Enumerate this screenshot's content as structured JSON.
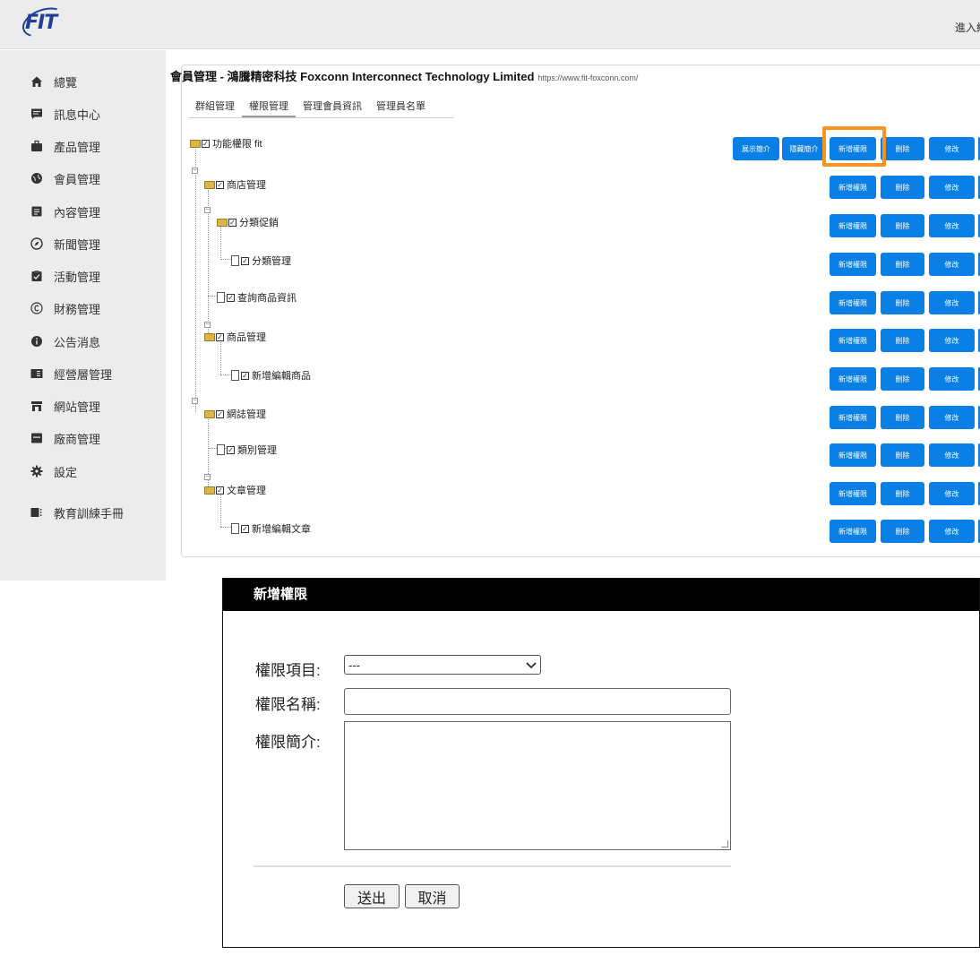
{
  "header": {
    "logo_text": "FIT",
    "right_text": "進入線"
  },
  "sidebar": {
    "items": [
      {
        "label": "總覽",
        "icon": "home-icon"
      },
      {
        "label": "訊息中心",
        "icon": "message-icon"
      },
      {
        "label": "產品管理",
        "icon": "briefcase-icon"
      },
      {
        "label": "會員管理",
        "icon": "globe-icon"
      },
      {
        "label": "內容管理",
        "icon": "document-icon"
      },
      {
        "label": "新聞管理",
        "icon": "compass-icon"
      },
      {
        "label": "活動管理",
        "icon": "clipboard-icon"
      },
      {
        "label": "財務管理",
        "icon": "copyright-icon"
      },
      {
        "label": "公告消息",
        "icon": "info-icon"
      },
      {
        "label": "經營層管理",
        "icon": "panel-icon"
      },
      {
        "label": "網站管理",
        "icon": "store-icon"
      },
      {
        "label": "廠商管理",
        "icon": "archive-icon"
      },
      {
        "label": "設定",
        "icon": "gear-icon"
      },
      {
        "label": "教育訓練手冊",
        "icon": "book-icon"
      }
    ]
  },
  "main": {
    "title": "會員管理 - 鴻騰精密科技 Foxconn Interconnect Technology Limited",
    "url": "https://www.fit-foxconn.com/",
    "tabs": [
      {
        "label": "群組管理"
      },
      {
        "label": "權限管理"
      },
      {
        "label": "管理會員資訊"
      },
      {
        "label": "管理員名單"
      }
    ],
    "active_tab": "權限管理",
    "tree": [
      {
        "label": "功能權限 fit",
        "type": "folder",
        "checked": true
      },
      {
        "label": "商店管理",
        "type": "folder",
        "checked": true
      },
      {
        "label": "分類促銷",
        "type": "folder",
        "checked": true
      },
      {
        "label": "分類管理",
        "type": "doc",
        "checked": true
      },
      {
        "label": "查詢商品資訊",
        "type": "doc",
        "checked": true
      },
      {
        "label": "商品管理",
        "type": "folder",
        "checked": true
      },
      {
        "label": "新增編輯商品",
        "type": "doc",
        "checked": true
      },
      {
        "label": "網誌管理",
        "type": "folder",
        "checked": true
      },
      {
        "label": "類別管理",
        "type": "doc",
        "checked": true
      },
      {
        "label": "文章管理",
        "type": "folder",
        "checked": true
      },
      {
        "label": "新增編輯文章",
        "type": "doc",
        "checked": true
      }
    ],
    "buttons": {
      "show_intro": "展示簡介",
      "hide_intro": "隱藏簡介",
      "add_permission": "新增權限",
      "delete": "刪除",
      "edit": "修改"
    }
  },
  "dialog": {
    "title": "新增權限",
    "item_label": "權限項目:",
    "item_value": "---",
    "name_label": "權限名稱:",
    "name_value": "",
    "desc_label": "權限簡介:",
    "desc_value": "",
    "submit_label": "送出",
    "cancel_label": "取消"
  },
  "colors": {
    "button_blue": "#0a7fe6",
    "highlight_orange": "#f7931e",
    "sidebar_bg": "#ececec"
  }
}
